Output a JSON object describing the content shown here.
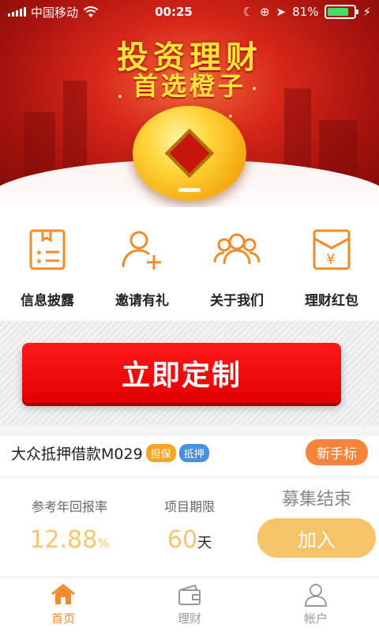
{
  "status_bar": {
    "carrier": "中国移动",
    "time": "00:25",
    "battery": "81%",
    "battery_level": 0.81
  },
  "banner": {
    "title_line1": "投资理财",
    "title_line2": "首选橙子"
  },
  "quick_menu": [
    {
      "label": "信息披露",
      "icon": "document-icon"
    },
    {
      "label": "邀请有礼",
      "icon": "add-user-icon"
    },
    {
      "label": "关于我们",
      "icon": "group-icon"
    },
    {
      "label": "理财红包",
      "icon": "red-envelope-icon"
    }
  ],
  "promo": {
    "button_label": "立即定制"
  },
  "product": {
    "name": "大众抵押借款M029",
    "tags": [
      "担保",
      "抵押"
    ],
    "badge": "新手标",
    "rate_label": "参考年回报率",
    "rate_value": "12.88",
    "rate_unit": "%",
    "term_label": "项目期限",
    "term_value": "60",
    "term_unit": "天",
    "status": "募集结束",
    "action_label": "加入"
  },
  "tab_bar": [
    {
      "label": "首页",
      "icon": "home-icon",
      "active": true
    },
    {
      "label": "理财",
      "icon": "wallet-icon",
      "active": false
    },
    {
      "label": "帐户",
      "icon": "user-icon",
      "active": false
    }
  ],
  "colors": {
    "accent": "#f08a2a",
    "promo_red": "#e10000",
    "rate_gold": "#f5c66a"
  }
}
